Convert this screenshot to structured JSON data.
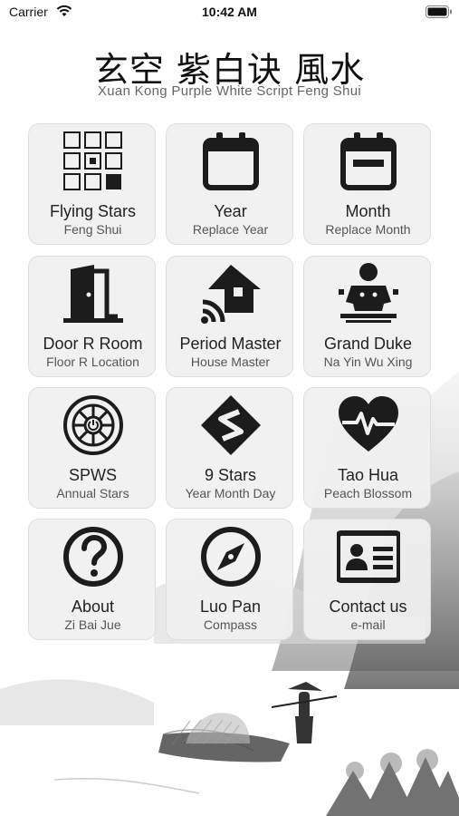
{
  "status_bar": {
    "carrier": "Carrier",
    "time": "10:42 AM"
  },
  "header": {
    "title_zh": "玄空 紫白诀 風水",
    "title_en": "Xuan Kong Purple White Script Feng Shui"
  },
  "tiles": [
    {
      "title": "Flying Stars",
      "subtitle": "Feng Shui",
      "icon": "flying-stars-grid-icon"
    },
    {
      "title": "Year",
      "subtitle": "Replace Year",
      "icon": "calendar-icon"
    },
    {
      "title": "Month",
      "subtitle": "Replace Month",
      "icon": "calendar-month-icon"
    },
    {
      "title": "Door R Room",
      "subtitle": "Floor R Location",
      "icon": "door-icon"
    },
    {
      "title": "Period Master",
      "subtitle": "House Master",
      "icon": "smart-home-icon"
    },
    {
      "title": "Grand Duke",
      "subtitle": "Na Yin Wu Xing",
      "icon": "grand-duke-icon"
    },
    {
      "title": "SPWS",
      "subtitle": "Annual Stars",
      "icon": "compass-wheel-icon"
    },
    {
      "title": "9 Stars",
      "subtitle": "Year Month Day",
      "icon": "nine-stars-icon"
    },
    {
      "title": "Tao Hua",
      "subtitle": "Peach Blossom",
      "icon": "heartbeat-icon"
    },
    {
      "title": "About",
      "subtitle": "Zi Bai Jue",
      "icon": "question-icon"
    },
    {
      "title": "Luo Pan",
      "subtitle": "Compass",
      "icon": "compass-icon"
    },
    {
      "title": "Contact us",
      "subtitle": "e-mail",
      "icon": "id-card-icon"
    }
  ],
  "colors": {
    "icon": "#1c1c1c",
    "tile_bg": "#f0f0f0",
    "subtitle": "#555555"
  }
}
